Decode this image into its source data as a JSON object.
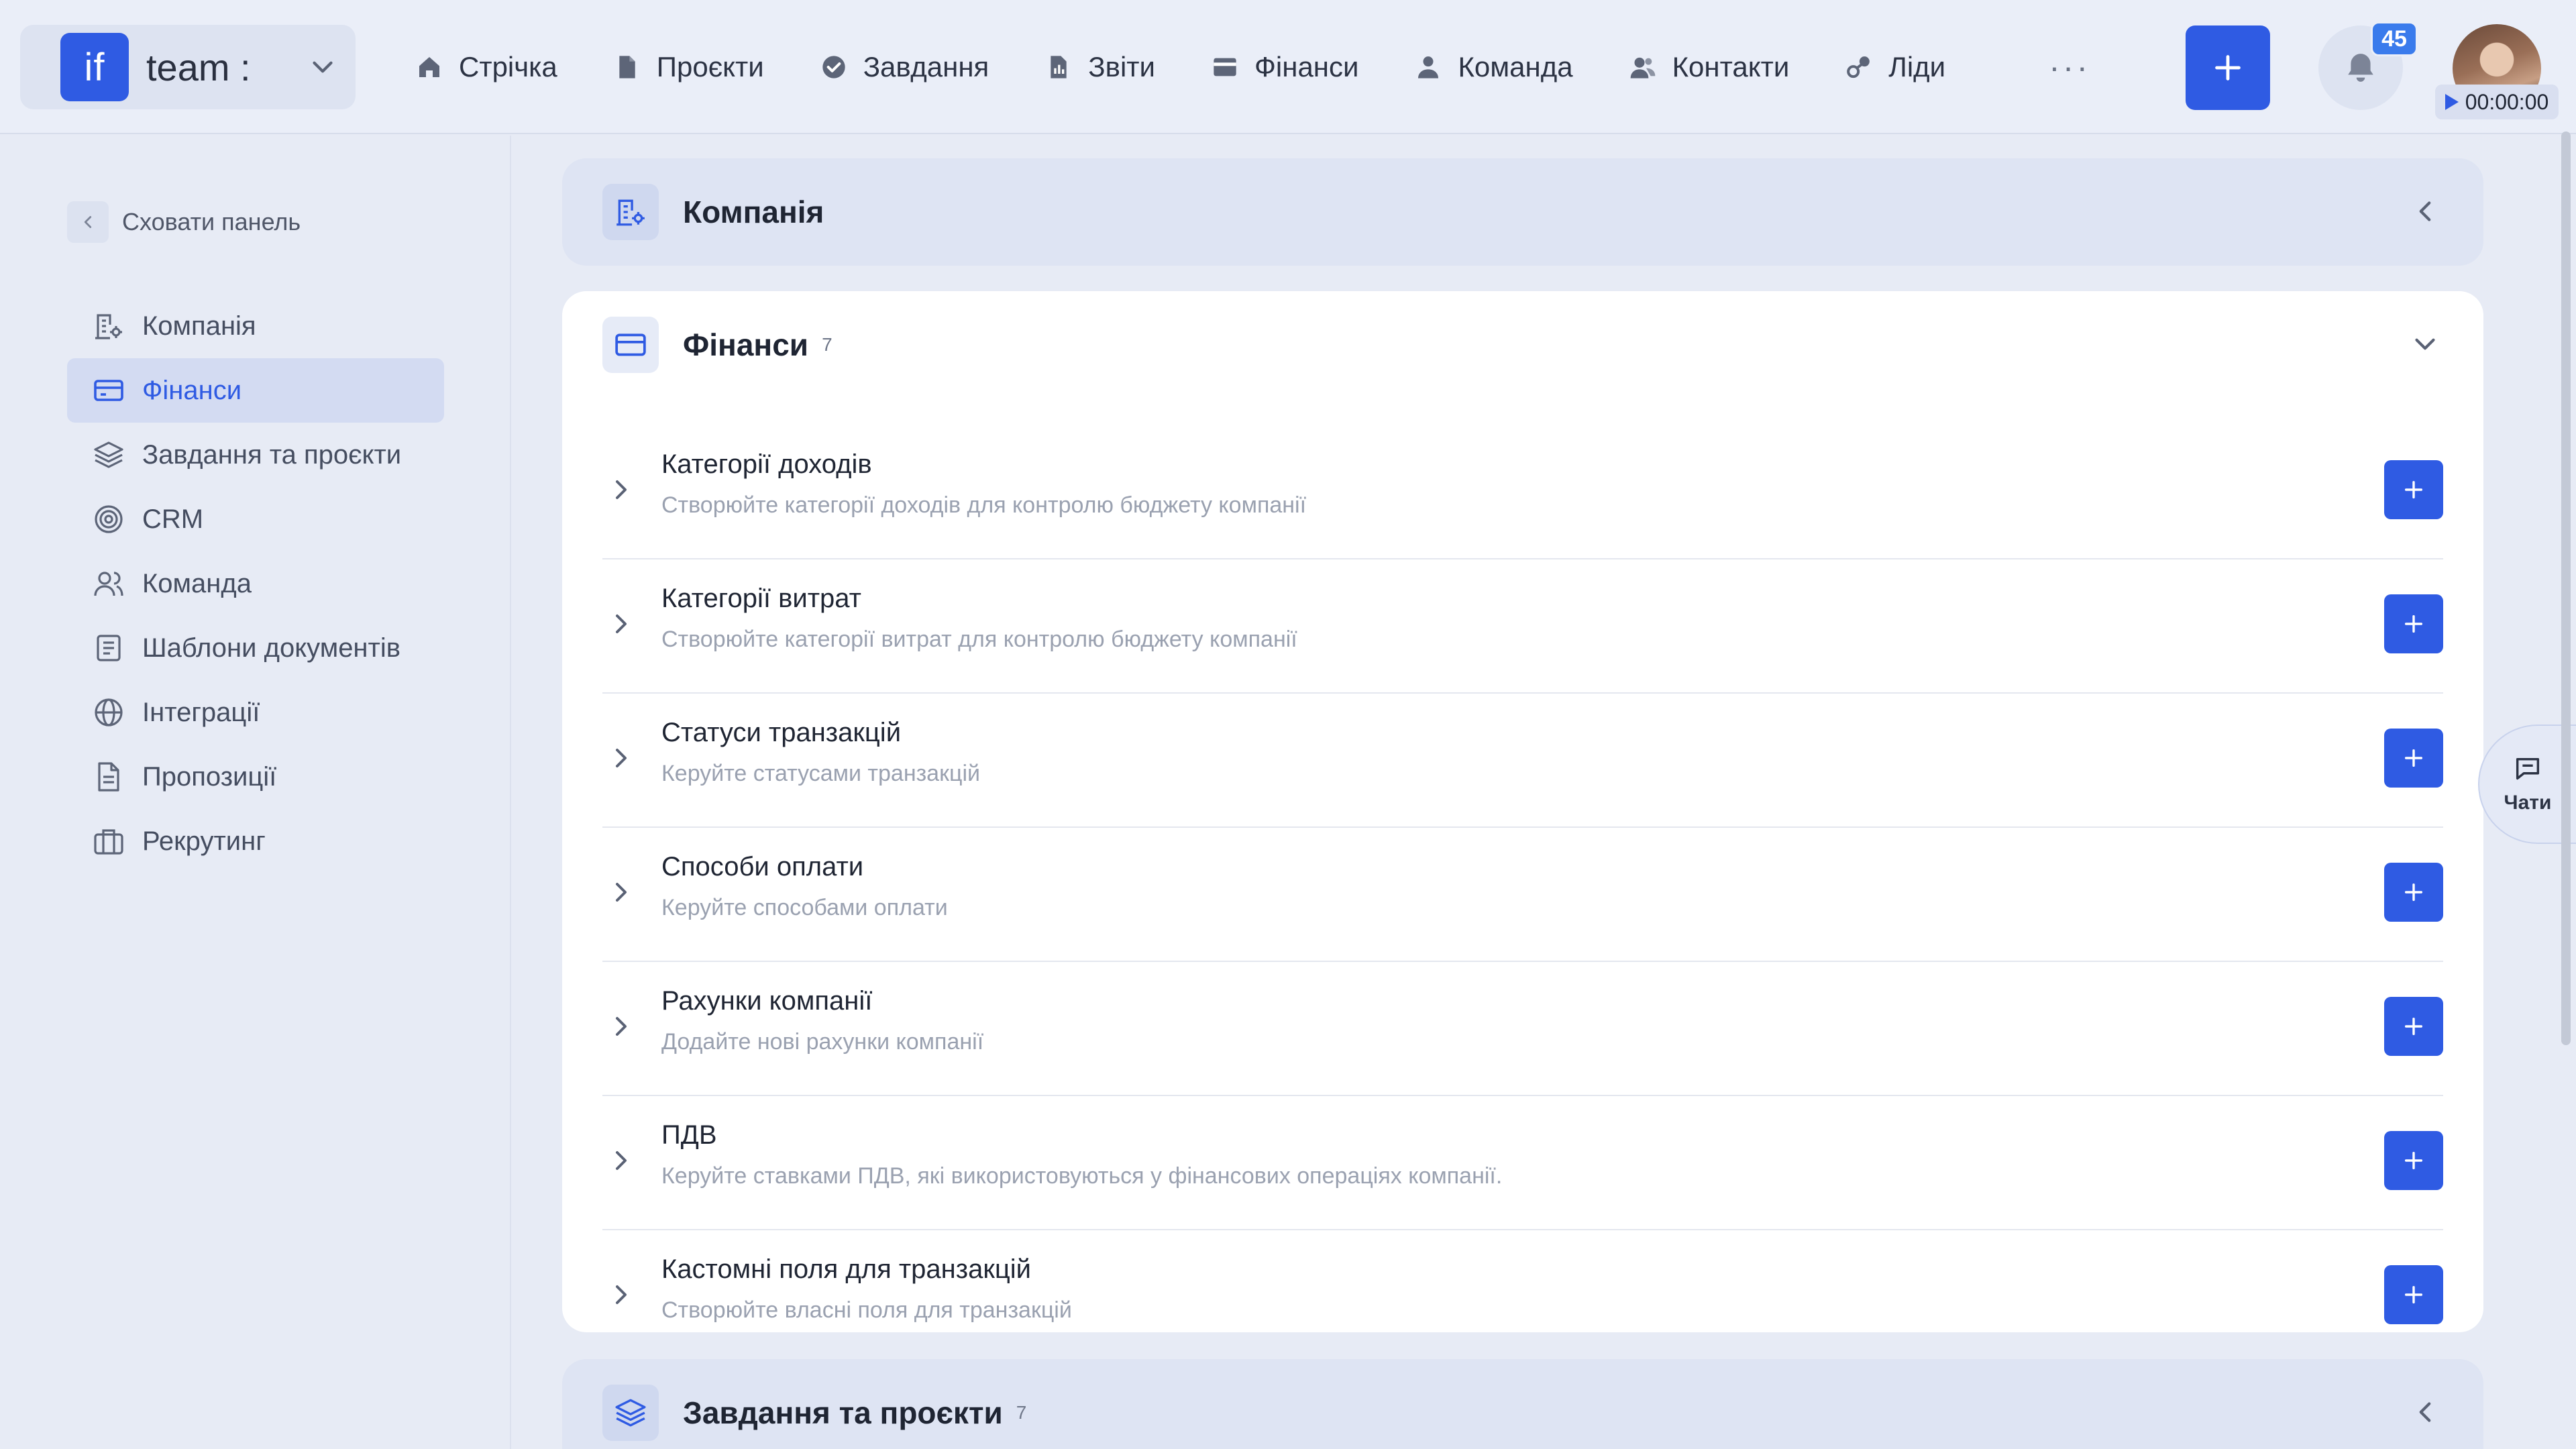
{
  "workspace": {
    "logo_text": "if",
    "name": "team :"
  },
  "nav": {
    "items": [
      {
        "label": "Стрічка",
        "icon": "home-icon"
      },
      {
        "label": "Проєкти",
        "icon": "document-icon"
      },
      {
        "label": "Завдання",
        "icon": "check-circle-icon"
      },
      {
        "label": "Звіти",
        "icon": "report-icon"
      },
      {
        "label": "Фінанси",
        "icon": "wallet-icon"
      },
      {
        "label": "Команда",
        "icon": "user-icon"
      },
      {
        "label": "Контакти",
        "icon": "contacts-icon"
      },
      {
        "label": "Ліди",
        "icon": "leads-icon"
      }
    ],
    "more_label": "···"
  },
  "header": {
    "notifications_count": "45",
    "timer": "00:00:00"
  },
  "sidebar": {
    "hide_label": "Сховати панель",
    "items": [
      {
        "label": "Компанія",
        "icon": "company-icon",
        "active": false
      },
      {
        "label": "Фінанси",
        "icon": "card-icon",
        "active": true
      },
      {
        "label": "Завдання та проєкти",
        "icon": "layers-icon",
        "active": false
      },
      {
        "label": "CRM",
        "icon": "target-icon",
        "active": false
      },
      {
        "label": "Команда",
        "icon": "users-icon",
        "active": false
      },
      {
        "label": "Шаблони документів",
        "icon": "template-icon",
        "active": false
      },
      {
        "label": "Інтеграції",
        "icon": "globe-icon",
        "active": false
      },
      {
        "label": "Пропозиції",
        "icon": "proposal-icon",
        "active": false
      },
      {
        "label": "Рекрутинг",
        "icon": "briefcase-icon",
        "active": false
      }
    ]
  },
  "sections": {
    "company": {
      "title": "Компанія"
    },
    "finance": {
      "title": "Фінанси",
      "count": "7",
      "rows": [
        {
          "title": "Категорії доходів",
          "desc": "Створюйте категорії доходів для контролю бюджету компанії"
        },
        {
          "title": "Категорії витрат",
          "desc": "Створюйте категорії витрат для контролю бюджету компанії"
        },
        {
          "title": "Статуси транзакцій",
          "desc": "Керуйте статусами транзакцій"
        },
        {
          "title": "Способи оплати",
          "desc": "Керуйте способами оплати"
        },
        {
          "title": "Рахунки компанії",
          "desc": "Додайте нові рахунки компанії"
        },
        {
          "title": "ПДВ",
          "desc": "Керуйте ставками ПДВ, які використовуються у фінансових операціях компанії."
        },
        {
          "title": "Кастомні поля для транзакцій",
          "desc": "Створюйте власні поля для транзакцій"
        }
      ]
    },
    "tasks": {
      "title": "Завдання та проєкти",
      "count": "7"
    }
  },
  "chat": {
    "label": "Чати"
  },
  "colors": {
    "accent": "#2f5be3",
    "background": "#e7ebf5",
    "card": "#ffffff",
    "muted_text": "#9aa1b0"
  }
}
